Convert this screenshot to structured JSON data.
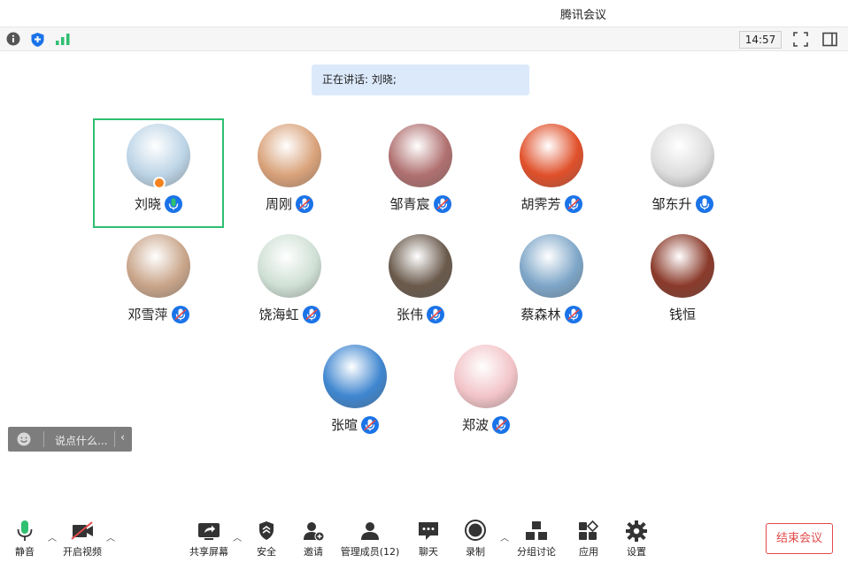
{
  "window": {
    "title": "腾讯会议"
  },
  "topbar": {
    "clock": "14:57"
  },
  "speaking": {
    "text": "正在讲话: 刘晓;"
  },
  "participants": [
    {
      "name": "刘晓",
      "mic": "active",
      "host": true,
      "color": "#bcd4e6"
    },
    {
      "name": "周刚",
      "mic": "muted",
      "color": "#d9a27a"
    },
    {
      "name": "邹青宸",
      "mic": "muted",
      "color": "#b07070"
    },
    {
      "name": "胡霁芳",
      "mic": "muted",
      "color": "#e0502a"
    },
    {
      "name": "邹东升",
      "mic": "on",
      "color": "#dddddd"
    },
    {
      "name": "邓雪萍",
      "mic": "muted",
      "color": "#c9a58a"
    },
    {
      "name": "饶海虹",
      "mic": "muted",
      "color": "#cfe0d5"
    },
    {
      "name": "张伟",
      "mic": "muted",
      "color": "#6a5a4c"
    },
    {
      "name": "蔡森林",
      "mic": "muted",
      "color": "#7ea6c8"
    },
    {
      "name": "钱恒",
      "mic": "none",
      "color": "#8a3a2a"
    },
    {
      "name": "张暄",
      "mic": "muted",
      "color": "#3f86d0"
    },
    {
      "name": "郑波",
      "mic": "muted",
      "color": "#f2c4c8"
    }
  ],
  "chat": {
    "placeholder": "说点什么..."
  },
  "bottom": {
    "mute": "静音",
    "video": "开启视频",
    "share": "共享屏幕",
    "security": "安全",
    "invite": "邀请",
    "members": "管理成员(12)",
    "chat": "聊天",
    "record": "录制",
    "breakout": "分组讨论",
    "apps": "应用",
    "settings": "设置",
    "end": "结束会议"
  },
  "colors": {
    "accent": "#1a73e8",
    "active_border": "#2fbf71",
    "end": "#e24a4a"
  }
}
